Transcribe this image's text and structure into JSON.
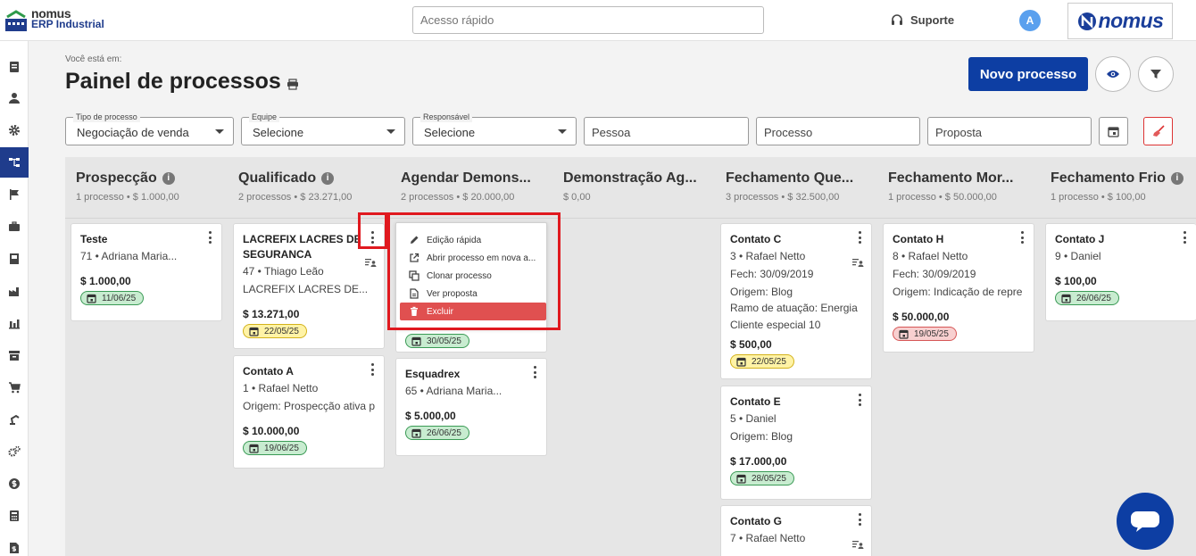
{
  "header": {
    "logo_line1": "nomus",
    "logo_line2": "ERP Industrial",
    "quick_access_placeholder": "Acesso rápido",
    "support_label": "Suporte",
    "avatar_letter": "A",
    "brand_name": "nomus"
  },
  "sidebar": {
    "icons": [
      "document-icon",
      "user-icon",
      "gear-icon",
      "process-flow-icon",
      "flag-icon",
      "briefcase-icon",
      "book-icon",
      "factory-icon",
      "chart-icon",
      "archive-icon",
      "cart-icon",
      "robot-arm-icon",
      "gears-icon",
      "dollar-icon",
      "calculator-icon",
      "file-dollar-icon"
    ],
    "active_index": 3
  },
  "page": {
    "breadcrumb": "Você está em:",
    "title": "Painel de processos",
    "new_button": "Novo processo"
  },
  "filters": {
    "tipo": {
      "label": "Tipo de processo",
      "value": "Negociação de venda"
    },
    "equipe": {
      "label": "Equipe",
      "value": "Selecione"
    },
    "responsavel": {
      "label": "Responsável",
      "value": "Selecione"
    },
    "pessoa_placeholder": "Pessoa",
    "processo_placeholder": "Processo",
    "proposta_placeholder": "Proposta"
  },
  "columns": [
    {
      "title": "Prospecção",
      "info": "i",
      "summary": "1 processo • $ 1.000,00"
    },
    {
      "title": "Qualificado",
      "info": "i",
      "summary": "2 processos • $ 23.271,00"
    },
    {
      "title": "Agendar Demons...",
      "info": "",
      "summary": "2 processos • $ 20.000,00"
    },
    {
      "title": "Demonstração Ag...",
      "info": "",
      "summary": "$ 0,00"
    },
    {
      "title": "Fechamento Que...",
      "info": "",
      "summary": "3 processos • $ 32.500,00"
    },
    {
      "title": "Fechamento Mor...",
      "info": "",
      "summary": "1 processo • $ 50.000,00"
    },
    {
      "title": "Fechamento Frio",
      "info": "i",
      "summary": "1 processo • $ 100,00"
    }
  ],
  "cards": {
    "teste": {
      "name": "Teste",
      "line1": "71 • Adriana Maria...",
      "value": "$ 1.000,00",
      "date": "11/06/25"
    },
    "lacrefix": {
      "name": "LACREFIX LACRES DE SEGURANCA",
      "line1": "47 • Thiago Leão",
      "line2": "LACREFIX LACRES DE...",
      "value": "$ 13.271,00",
      "date": "22/05/25"
    },
    "contato_a": {
      "name": "Contato A",
      "line1": "1 • Rafael Netto",
      "line2": "Origem: Prospecção ativa p",
      "value": "$ 10.000,00",
      "date": "19/06/25"
    },
    "agendar_hidden": {
      "date": "30/05/25"
    },
    "esquadrex": {
      "name": "Esquadrex",
      "line1": "65 • Adriana Maria...",
      "value": "$ 5.000,00",
      "date": "26/06/25"
    },
    "contato_c": {
      "name": "Contato C",
      "line1": "3 • Rafael Netto",
      "line2": "Fech: 30/09/2019",
      "line3": "Origem: Blog",
      "line4": "Ramo de atuação: Energia",
      "line5": "Cliente especial 10",
      "value": "$ 500,00",
      "date": "22/05/25"
    },
    "contato_e": {
      "name": "Contato E",
      "line1": "5 • Daniel",
      "line2": "Origem: Blog",
      "value": "$ 17.000,00",
      "date": "28/05/25"
    },
    "contato_g": {
      "name": "Contato G",
      "line1": "7 • Rafael Netto"
    },
    "contato_h": {
      "name": "Contato H",
      "line1": "8 • Rafael Netto",
      "line2": "Fech: 30/09/2019",
      "line3": "Origem: Indicação de repre",
      "value": "$ 50.000,00",
      "date": "19/05/25"
    },
    "contato_j": {
      "name": "Contato J",
      "line1": "9 • Daniel",
      "value": "$ 100,00",
      "date": "26/06/25"
    }
  },
  "context_menu": {
    "items": [
      "Edição rápida",
      "Abrir processo em nova a...",
      "Clonar processo",
      "Ver proposta",
      "Excluir"
    ]
  },
  "colors": {
    "primary": "#0d3ea3",
    "danger": "#e05050",
    "highlight": "#e0191f"
  }
}
